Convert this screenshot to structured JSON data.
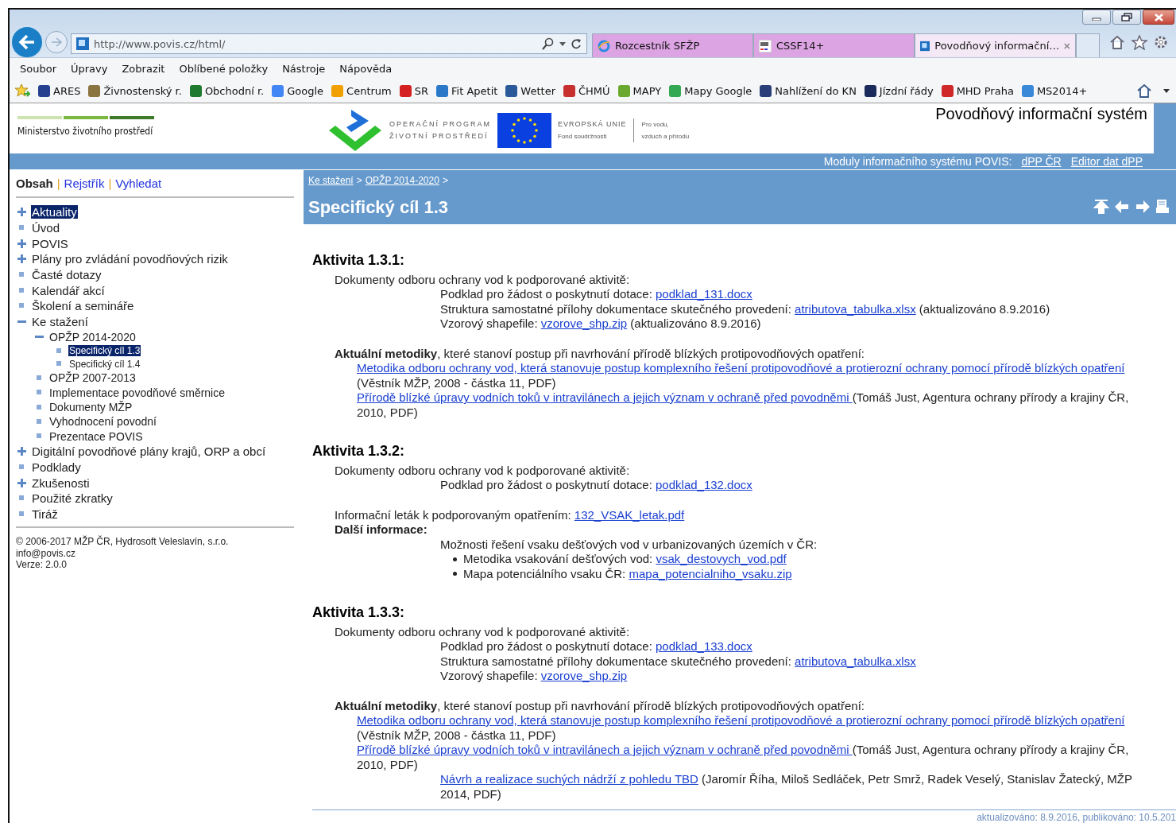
{
  "browser": {
    "address": "http://www.povis.cz/html/",
    "tabs": [
      {
        "label": "Rozcestník SFŽP",
        "selected": false
      },
      {
        "label": "CSSF14+",
        "selected": false
      },
      {
        "label": "Povodňový informační…",
        "selected": true
      }
    ],
    "menu": [
      "Soubor",
      "Úpravy",
      "Zobrazit",
      "Oblíbené položky",
      "Nástroje",
      "Nápověda"
    ],
    "favorites": [
      {
        "label": "ARES",
        "color": "#24408f"
      },
      {
        "label": "Živnostenský r.",
        "color": "#8a7440"
      },
      {
        "label": "Obchodní r.",
        "color": "#1e7a2e"
      },
      {
        "label": "Google",
        "color": "#4285f4"
      },
      {
        "label": "Centrum",
        "color": "#f0a000"
      },
      {
        "label": "SR",
        "color": "#d42020"
      },
      {
        "label": "Fit Apetit",
        "color": "#2a78c8"
      },
      {
        "label": "Wetter",
        "color": "#2a5a9a"
      },
      {
        "label": "ČHMÚ",
        "color": "#c83030"
      },
      {
        "label": "MAPY",
        "color": "#6aa830"
      },
      {
        "label": "Mapy Google",
        "color": "#34a853"
      },
      {
        "label": "Nahlížení do KN",
        "color": "#2a3f7a"
      },
      {
        "label": "Jízdní řády",
        "color": "#1a2a5a"
      },
      {
        "label": "MHD Praha",
        "color": "#d02828"
      },
      {
        "label": "MS2014+",
        "color": "#3a88d8"
      }
    ]
  },
  "header": {
    "ministry": "Ministerstvo životního prostředí",
    "program_line_1": "OPERAČNÍ PROGRAM",
    "program_line_2": "ŽIVOTNÍ PROSTŘEDÍ",
    "eu_name": "EVROPSKÁ UNIE",
    "eu_fund": "Fond soudržnosti",
    "motto_line_1": "Pro vodu,",
    "motto_line_2": "vzduch a přírodu",
    "site_title": "Povodňový informační systém",
    "modules_label": "Moduly informačního systému POVIS:",
    "module_links": [
      "dPP ČR",
      "Editor dat dPP"
    ]
  },
  "sidebar": {
    "tabs": [
      {
        "label": "Obsah",
        "selected": true
      },
      {
        "label": "Rejstřík",
        "selected": false
      },
      {
        "label": "Vyhledat",
        "selected": false
      }
    ],
    "separators": [
      "|",
      "|"
    ],
    "tree": [
      {
        "label": "Aktuality",
        "kind": "folder",
        "expanded": false,
        "selected": true
      },
      {
        "label": "Úvod",
        "kind": "page",
        "selected": false
      },
      {
        "label": "POVIS",
        "kind": "folder",
        "expanded": false,
        "selected": false
      },
      {
        "label": "Plány pro zvládání povodňových rizik",
        "kind": "folder",
        "expanded": false,
        "selected": false
      },
      {
        "label": "Časté dotazy",
        "kind": "page",
        "selected": false
      },
      {
        "label": "Kalendář akcí",
        "kind": "page",
        "selected": false
      },
      {
        "label": "Školení a semináře",
        "kind": "page",
        "selected": false
      },
      {
        "label": "Ke stažení",
        "kind": "folder",
        "expanded": true,
        "selected": false,
        "children": [
          {
            "label": "OPŽP 2014-2020",
            "kind": "folder",
            "expanded": true,
            "selected": false,
            "children": [
              {
                "label": "Specifický cíl 1.3",
                "kind": "page",
                "selected": true
              },
              {
                "label": "Specifický cíl 1.4",
                "kind": "page",
                "selected": false
              }
            ]
          },
          {
            "label": "OPŽP 2007-2013",
            "kind": "page",
            "selected": false
          },
          {
            "label": "Implementace povodňové směrnice",
            "kind": "page",
            "selected": false
          },
          {
            "label": "Dokumenty MŽP",
            "kind": "page",
            "selected": false
          },
          {
            "label": "Vyhodnocení povodní",
            "kind": "page",
            "selected": false
          },
          {
            "label": "Prezentace POVIS",
            "kind": "page",
            "selected": false
          }
        ]
      },
      {
        "label": "Digitální povodňové plány krajů, ORP a obcí",
        "kind": "folder",
        "expanded": false,
        "selected": false
      },
      {
        "label": "Podklady",
        "kind": "page",
        "selected": false
      },
      {
        "label": "Zkušenosti",
        "kind": "folder",
        "expanded": false,
        "selected": false
      },
      {
        "label": "Použité zkratky",
        "kind": "page",
        "selected": false
      },
      {
        "label": "Tiráž",
        "kind": "page",
        "selected": false
      }
    ],
    "footer": [
      "© 2006-2017 MŽP ČR, Hydrosoft Veleslavín, s.r.o.",
      "info@povis.cz",
      "Verze: 2.0.0"
    ]
  },
  "content": {
    "breadcrumb": [
      {
        "label": "Ke stažení",
        "separator": ">"
      },
      {
        "label": "OPŽP 2014-2020",
        "separator": ">"
      }
    ],
    "title": "Specifický cíl 1.3",
    "activities": [
      {
        "heading": "Aktivita 1.3.1:",
        "groups": [
          {
            "kind": "documents",
            "lead": [
              {
                "kind": "text",
                "text": "Dokumenty odboru ochrany vod k podporované aktivitě:"
              }
            ],
            "items": [
              {
                "segments": [
                  {
                    "kind": "text",
                    "text": "Podklad pro žádost o poskytnutí dotace: "
                  },
                  {
                    "kind": "link",
                    "text": "podklad_131.docx"
                  }
                ]
              },
              {
                "segments": [
                  {
                    "kind": "text",
                    "text": "Struktura samostatné přílohy dokumentace skutečného provedení: "
                  },
                  {
                    "kind": "link",
                    "text": "atributova_tabulka.xlsx"
                  },
                  {
                    "kind": "text",
                    "text": " (aktualizováno 8.9.2016)"
                  }
                ]
              },
              {
                "segments": [
                  {
                    "kind": "text",
                    "text": "Vzorový shapefile: "
                  },
                  {
                    "kind": "link",
                    "text": "vzorove_shp.zip"
                  },
                  {
                    "kind": "text",
                    "text": " (aktualizováno 8.9.2016)"
                  }
                ]
              }
            ]
          },
          {
            "kind": "methods",
            "lead": [
              {
                "kind": "text",
                "text": "**Aktuální metodiky**, které stanoví postup při navrhování přírodě blízkých protipovodňových opatření:"
              }
            ],
            "items": [
              {
                "indented": false,
                "segments": [
                  {
                    "kind": "link",
                    "text": "Metodika odboru ochrany vod, která stanovuje postup komplexního řešení protipovodňové a protierozní ochrany pomocí přírodě blízkých opatření"
                  },
                  {
                    "kind": "text",
                    "text": " (Věstník MŽP, 2008 - částka 11, PDF)"
                  }
                ]
              },
              {
                "indented": false,
                "segments": [
                  {
                    "kind": "link",
                    "text": "Přírodě blízké úpravy vodních toků v intravilánech a jejich význam v ochraně před povodněmi "
                  },
                  {
                    "kind": "text",
                    "text": "(Tomáš Just, Agentura ochrany přírody a krajiny ČR, 2010, PDF)"
                  }
                ]
              }
            ]
          }
        ]
      },
      {
        "heading": "Aktivita 1.3.2:",
        "groups": [
          {
            "kind": "documents",
            "lead": [
              {
                "kind": "text",
                "text": "Dokumenty odboru ochrany vod k podporované aktivitě:"
              }
            ],
            "items": [
              {
                "segments": [
                  {
                    "kind": "text",
                    "text": "Podklad pro žádost o poskytnutí dotace: "
                  },
                  {
                    "kind": "link",
                    "text": "podklad_132.docx"
                  }
                ]
              }
            ]
          },
          {
            "kind": "leaflet",
            "lead": [
              {
                "kind": "text",
                "text": "Informační leták k podporovaným opatřením: "
              },
              {
                "kind": "link",
                "text": "132_VSAK_letak.pdf"
              }
            ]
          },
          {
            "kind": "info",
            "lead": [
              {
                "kind": "text",
                "text": "Další informace:"
              }
            ],
            "items": [
              {
                "segments": [
                  {
                    "kind": "text",
                    "text": "Možnosti řešení vsaku dešťových vod v urbanizovaných územích v ČR:"
                  }
                ],
                "bullets": [
                  [
                    {
                      "kind": "text",
                      "text": "Metodika vsakování dešťových vod: "
                    },
                    {
                      "kind": "link",
                      "text": "vsak_destovych_vod.pdf"
                    }
                  ],
                  [
                    {
                      "kind": "text",
                      "text": "Mapa potenciálního vsaku ČR: "
                    },
                    {
                      "kind": "link",
                      "text": "mapa_potencialniho_vsaku.zip"
                    }
                  ]
                ]
              }
            ]
          }
        ]
      },
      {
        "heading": "Aktivita 1.3.3:",
        "groups": [
          {
            "kind": "documents",
            "lead": [
              {
                "kind": "text",
                "text": "Dokumenty odboru ochrany vod k podporované aktivitě:"
              }
            ],
            "items": [
              {
                "segments": [
                  {
                    "kind": "text",
                    "text": "Podklad pro žádost o poskytnutí dotace: "
                  },
                  {
                    "kind": "link",
                    "text": "podklad_133.docx"
                  }
                ]
              },
              {
                "segments": [
                  {
                    "kind": "text",
                    "text": "Struktura samostatné přílohy dokumentace skutečného provedení: "
                  },
                  {
                    "kind": "link",
                    "text": "atributova_tabulka.xlsx"
                  }
                ]
              },
              {
                "segments": [
                  {
                    "kind": "text",
                    "text": "Vzorový shapefile: "
                  },
                  {
                    "kind": "link",
                    "text": "vzorove_shp.zip"
                  }
                ]
              }
            ]
          },
          {
            "kind": "methods",
            "lead": [
              {
                "kind": "text",
                "text": "**Aktuální metodiky**, které stanoví postup při navrhování přírodě blízkých protipovodňových opatření:"
              }
            ],
            "items": [
              {
                "indented": false,
                "segments": [
                  {
                    "kind": "link",
                    "text": "Metodika odboru ochrany vod, která stanovuje postup komplexního řešení protipovodňové a protierozní ochrany pomocí přírodě blízkých opatření"
                  },
                  {
                    "kind": "text",
                    "text": " (Věstník MŽP, 2008 - částka 11, PDF)"
                  }
                ]
              },
              {
                "indented": false,
                "segments": [
                  {
                    "kind": "link",
                    "text": "Přírodě blízké úpravy vodních toků v intravilánech a jejich význam v ochraně před povodněmi "
                  },
                  {
                    "kind": "text",
                    "text": "(Tomáš Just, Agentura ochrany přírody a krajiny ČR, 2010, PDF)"
                  }
                ]
              },
              {
                "indented": true,
                "segments": [
                  {
                    "kind": "link",
                    "text": "Návrh a realizace suchých nádrží z pohledu TBD"
                  },
                  {
                    "kind": "text",
                    "text": "  (Jaromír Říha, Miloš Sedláček, Petr Smrž, Radek Veselý, Stanislav Žatecký, MŽP 2014, PDF)"
                  }
                ]
              }
            ]
          }
        ]
      }
    ],
    "footer": "aktualizováno: 8.9.2016, publikováno: 10.5.201"
  }
}
